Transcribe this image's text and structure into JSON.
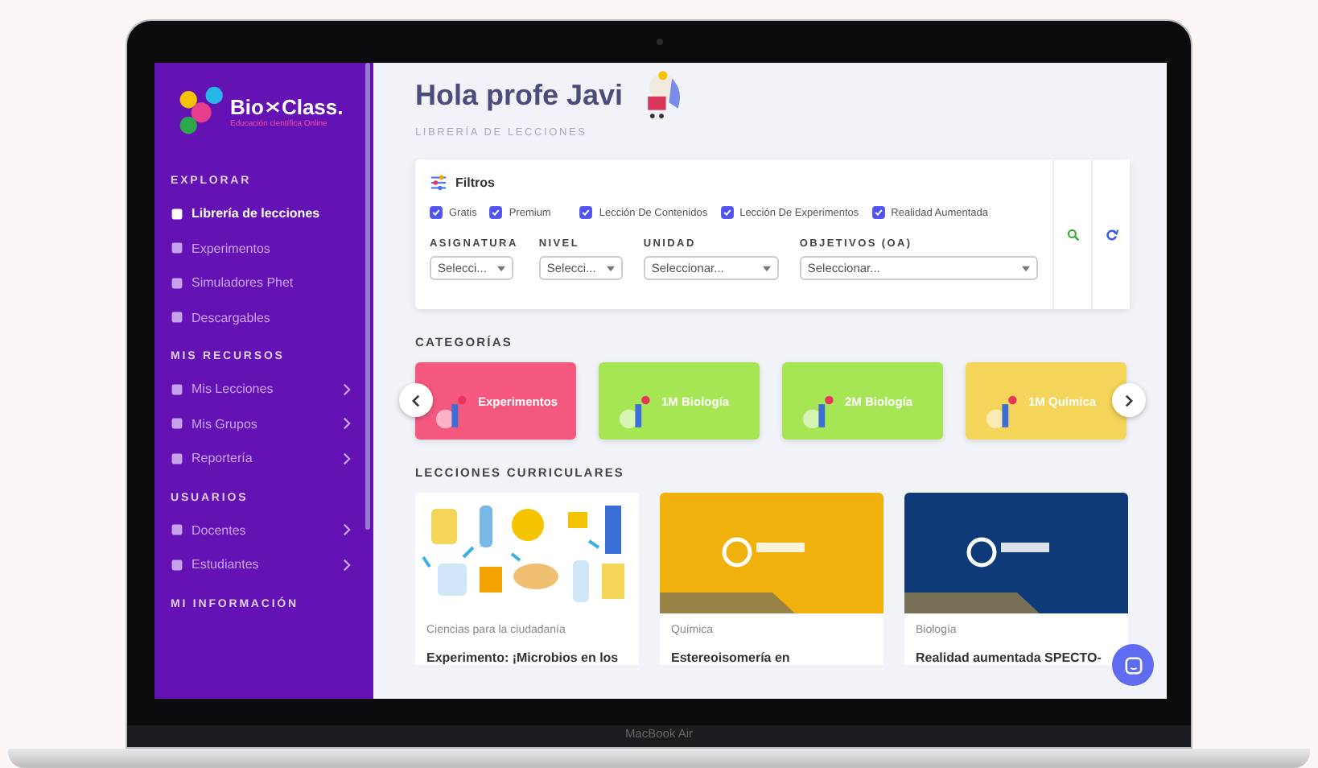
{
  "sidebar": {
    "logo": {
      "word_1": "Bio",
      "word_2": "Class.",
      "tagline": "Educación científica Online"
    },
    "sections": [
      {
        "title": "EXPLORAR",
        "items": [
          {
            "label": "Librería de lecciones",
            "selected": true,
            "has_submenu": false
          },
          {
            "label": "Experimentos",
            "selected": false,
            "has_submenu": false
          },
          {
            "label": "Simuladores Phet",
            "selected": false,
            "has_submenu": false
          },
          {
            "label": "Descargables",
            "selected": false,
            "has_submenu": false
          }
        ]
      },
      {
        "title": "MIS RECURSOS",
        "items": [
          {
            "label": "Mis Lecciones",
            "selected": false,
            "has_submenu": true
          },
          {
            "label": "Mis Grupos",
            "selected": false,
            "has_submenu": true
          },
          {
            "label": "Reportería",
            "selected": false,
            "has_submenu": true
          }
        ]
      },
      {
        "title": "USUARIOS",
        "items": [
          {
            "label": "Docentes",
            "selected": false,
            "has_submenu": true
          },
          {
            "label": "Estudiantes",
            "selected": false,
            "has_submenu": true
          }
        ]
      },
      {
        "title": "MI INFORMACIÓN"
      }
    ]
  },
  "header": {
    "greeting": "Hola profe Javi",
    "breadcrumb": "LIBRERÍA DE LECCIONES"
  },
  "filters": {
    "title": "Filtros",
    "options": [
      {
        "label": "Gratis",
        "checked": true
      },
      {
        "label": "Premium",
        "checked": true
      },
      {
        "label": "Lección De Contenidos",
        "checked": true
      },
      {
        "label": "Lección De Experimentos",
        "checked": true
      },
      {
        "label": "Realidad Aumentada",
        "checked": true
      }
    ],
    "fields": [
      {
        "label": "ASIGNATURA",
        "placeholder": "Selecci..."
      },
      {
        "label": "NIVEL",
        "placeholder": "Selecci..."
      },
      {
        "label": "UNIDAD",
        "placeholder": "Seleccionar..."
      },
      {
        "label": "OBJETIVOS (OA)",
        "placeholder": "Seleccionar..."
      }
    ]
  },
  "categories": {
    "title": "CATEGORÍAS",
    "items": [
      {
        "label": "Experimentos",
        "color": "#f5587f"
      },
      {
        "label": "1M Biología",
        "color": "#a6e655"
      },
      {
        "label": "2M Biología",
        "color": "#a6e655"
      },
      {
        "label": "1M Química",
        "color": "#f5d45a"
      }
    ]
  },
  "lessons": {
    "title": "LECCIONES CURRICULARES",
    "items": [
      {
        "kind": "illustration",
        "color": "#ffffff",
        "subject": "Ciencias para la ciudadanía",
        "title": "Experimento: ¡Microbios en los"
      },
      {
        "kind": "cover",
        "color": "#f0b10c",
        "subject": "Química",
        "title": "Estereoisomería en"
      },
      {
        "kind": "cover",
        "color": "#0e3a78",
        "subject": "Biología",
        "title": "Realidad aumentada SPECTO-"
      }
    ]
  },
  "device": {
    "label": "MacBook Air"
  }
}
